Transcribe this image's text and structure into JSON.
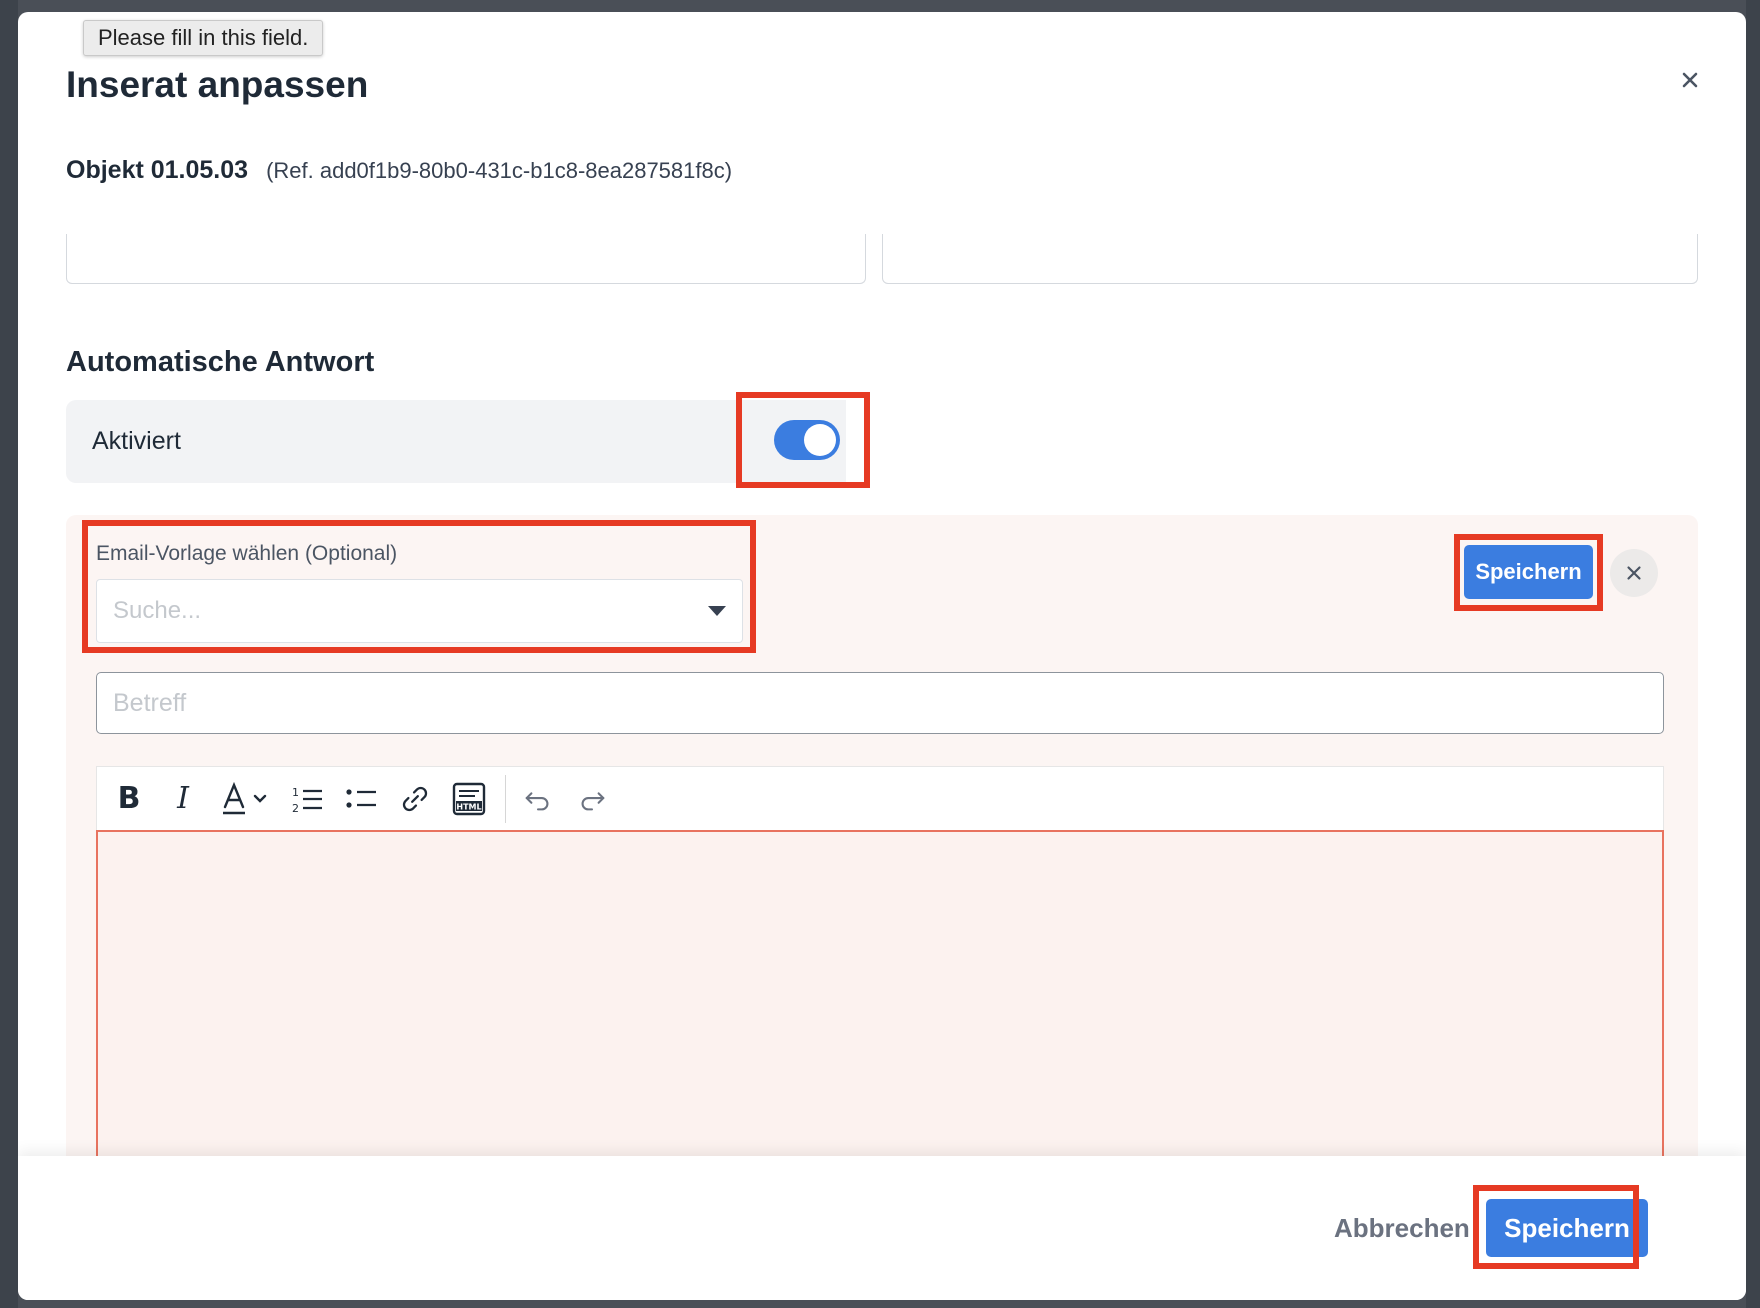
{
  "tooltip": {
    "text": "Please fill in this field."
  },
  "modal": {
    "title": "Inserat anpassen",
    "object_name": "Objekt 01.05.03",
    "object_ref": "(Ref. add0f1b9-80b0-431c-b1c8-8ea287581f8c)"
  },
  "autoresponse": {
    "section_title": "Automatische Antwort",
    "toggle_label": "Aktiviert",
    "toggle_on": true,
    "template_label": "Email-Vorlage wählen (Optional)",
    "template_placeholder": "Suche...",
    "save_label": "Speichern",
    "subject_placeholder": "Betreff",
    "subject_value": "",
    "toolbar": [
      "bold-icon",
      "italic-icon",
      "font-color-icon",
      "ordered-list-icon",
      "bullet-list-icon",
      "link-icon",
      "html-icon",
      "undo-icon",
      "redo-icon"
    ]
  },
  "footer": {
    "cancel_label": "Abbrechen",
    "save_label": "Speichern"
  },
  "colors": {
    "accent": "#3b7de0",
    "highlight": "#e63a23",
    "panel_bg": "#fcf5f3",
    "editor_border": "#e8735f"
  }
}
